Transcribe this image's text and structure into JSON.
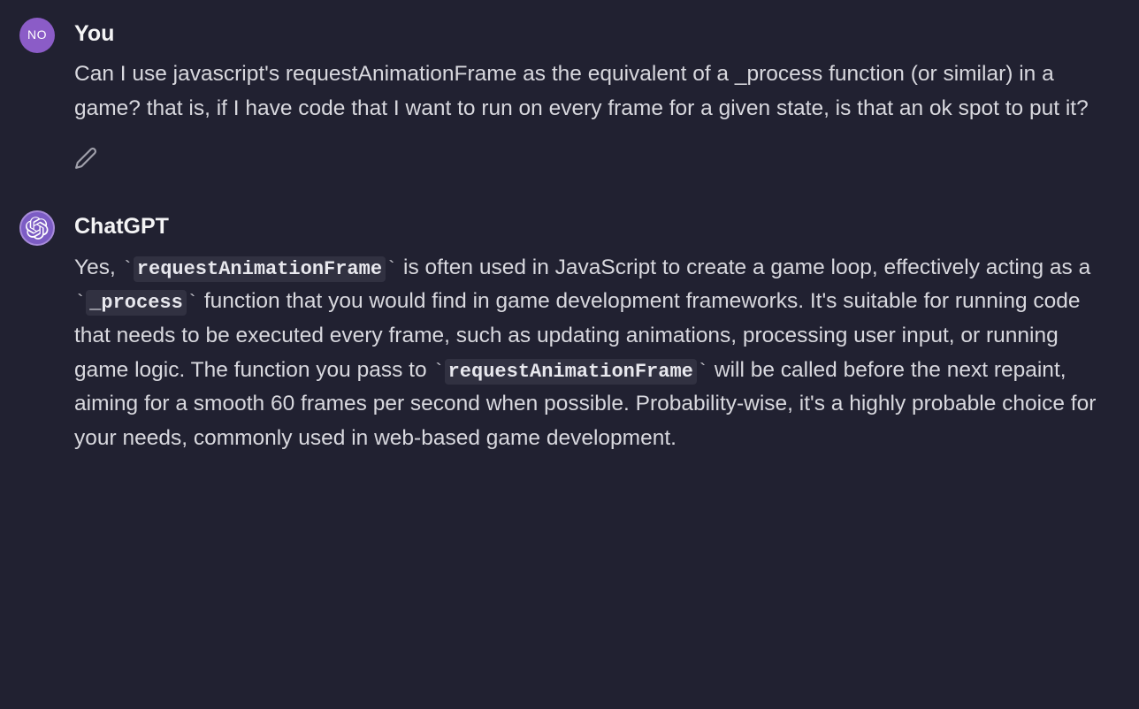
{
  "messages": {
    "user": {
      "avatar_initials": "NO",
      "author": "You",
      "text": "Can I use javascript's requestAnimationFrame as the equivalent of a _process function (or similar) in a game? that is, if I have code that I want to run on every frame for a given state, is that an ok spot to put it?"
    },
    "assistant": {
      "author": "ChatGPT",
      "text_part1": "Yes, ",
      "code1": "requestAnimationFrame",
      "text_part2": " is often used in JavaScript to create a game loop, effectively acting as a ",
      "code2": "_process",
      "text_part3": " function that you would find in game development frameworks. It's suitable for running code that needs to be executed every frame, such as updating animations, processing user input, or running game logic. The function you pass to ",
      "code3": "requestAnimationFrame",
      "text_part4": " will be called before the next repaint, aiming for a smooth 60 frames per second when possible. Probability-wise, it's a highly probable choice for your needs, commonly used in web-based game development."
    }
  }
}
